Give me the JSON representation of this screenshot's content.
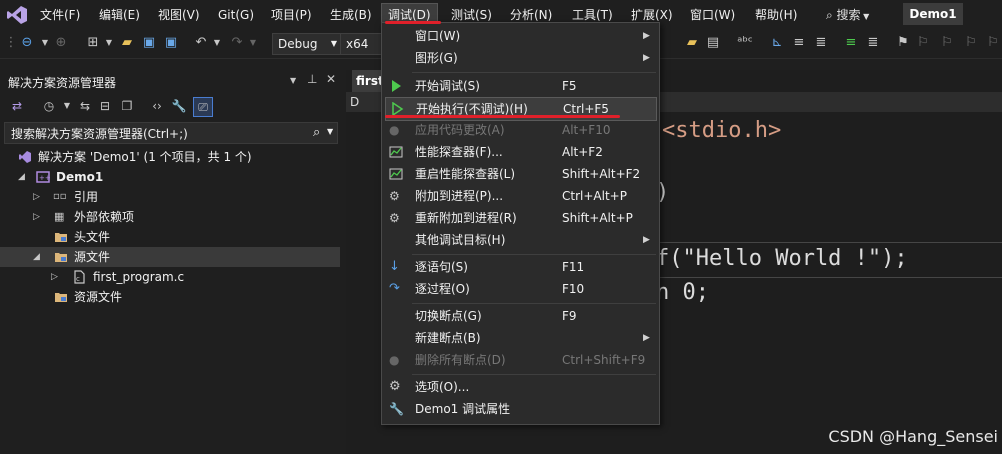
{
  "menubar": {
    "items": [
      "文件(F)",
      "编辑(E)",
      "视图(V)",
      "Git(G)",
      "项目(P)",
      "生成(B)",
      "调试(D)",
      "测试(S)",
      "分析(N)",
      "工具(T)",
      "扩展(X)",
      "窗口(W)",
      "帮助(H)"
    ],
    "search_label": "搜索",
    "solution_name": "Demo1"
  },
  "toolbar": {
    "config": "Debug",
    "platform": "x64"
  },
  "solution_explorer": {
    "title": "解决方案资源管理器",
    "search_placeholder": "搜索解决方案资源管理器(Ctrl+;)",
    "tree": [
      {
        "label": "解决方案 'Demo1' (1 个项目，共 1 个)",
        "bold": false
      },
      {
        "label": "Demo1",
        "bold": true
      },
      {
        "label": "引用"
      },
      {
        "label": "外部依赖项"
      },
      {
        "label": "头文件"
      },
      {
        "label": "源文件"
      },
      {
        "label": "first_program.c"
      },
      {
        "label": "资源文件"
      }
    ]
  },
  "editor": {
    "tab_label": "first",
    "bar_label": "D",
    "code_lines": [
      "<stdio.h>",
      ")",
      "f(\"Hello World !\");",
      "n 0;"
    ]
  },
  "debug_menu": {
    "items": [
      {
        "label": "窗口(W)",
        "shortcut": "",
        "submenu": true
      },
      {
        "label": "图形(G)",
        "shortcut": "",
        "submenu": true
      },
      {
        "label": "开始调试(S)",
        "shortcut": "F5"
      },
      {
        "label": "开始执行(不调试)(H)",
        "shortcut": "Ctrl+F5"
      },
      {
        "label": "应用代码更改(A)",
        "shortcut": "Alt+F10",
        "disabled": true
      },
      {
        "label": "性能探查器(F)...",
        "shortcut": "Alt+F2"
      },
      {
        "label": "重启性能探查器(L)",
        "shortcut": "Shift+Alt+F2"
      },
      {
        "label": "附加到进程(P)...",
        "shortcut": "Ctrl+Alt+P"
      },
      {
        "label": "重新附加到进程(R)",
        "shortcut": "Shift+Alt+P"
      },
      {
        "label": "其他调试目标(H)",
        "shortcut": "",
        "submenu": true
      },
      {
        "label": "逐语句(S)",
        "shortcut": "F11"
      },
      {
        "label": "逐过程(O)",
        "shortcut": "F10"
      },
      {
        "label": "切换断点(G)",
        "shortcut": "F9"
      },
      {
        "label": "新建断点(B)",
        "shortcut": "",
        "submenu": true
      },
      {
        "label": "删除所有断点(D)",
        "shortcut": "Ctrl+Shift+F9",
        "disabled": true
      },
      {
        "label": "选项(O)...",
        "shortcut": ""
      },
      {
        "label": "Demo1 调试属性",
        "shortcut": ""
      }
    ]
  },
  "watermark": "CSDN @Hang_Sensei",
  "colors": {
    "accent_red": "#e0202a",
    "play_green": "#4ec94e",
    "vs_purple": "#8c5cd6",
    "string_orange": "#d69d85",
    "code_text": "#dcdcdc"
  }
}
